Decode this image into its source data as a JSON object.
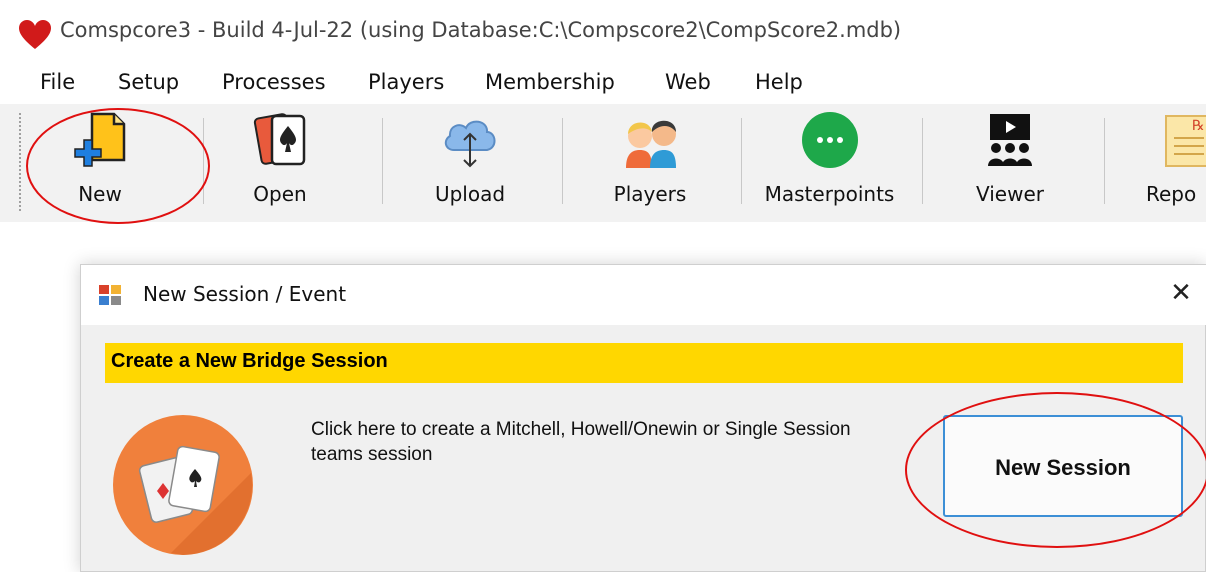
{
  "window": {
    "title": "Comspcore3 - Build 4-Jul-22 (using Database:C:\\Compscore2\\CompScore2.mdb)",
    "icon": "heart-icon"
  },
  "menu": [
    "File",
    "Setup",
    "Processes",
    "Players",
    "Membership",
    "Web",
    "Help"
  ],
  "toolbar": [
    {
      "label": "New",
      "icon": "new-document-icon"
    },
    {
      "label": "Open",
      "icon": "playing-card-icon"
    },
    {
      "label": "Upload",
      "icon": "cloud-upload-icon"
    },
    {
      "label": "Players",
      "icon": "players-icon"
    },
    {
      "label": "Masterpoints",
      "icon": "ellipsis-circle-icon"
    },
    {
      "label": "Viewer",
      "icon": "viewer-audience-icon"
    },
    {
      "label": "Repo",
      "icon": "report-icon"
    }
  ],
  "dialog": {
    "title": "New Session / Event",
    "close": "✕",
    "banner": "Create a New Bridge Session",
    "description": "Click here to create a Mitchell, Howell/Onewin or Single Session teams session",
    "button": "New Session"
  },
  "colors": {
    "banner": "#ffd700",
    "annotation": "#e01010",
    "button_border": "#3c8fd6",
    "session_icon": "#f0803c"
  }
}
